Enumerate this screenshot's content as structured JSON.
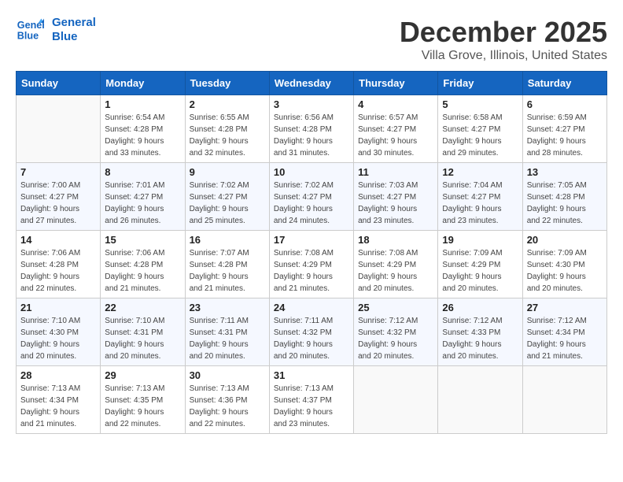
{
  "header": {
    "logo_line1": "General",
    "logo_line2": "Blue",
    "month": "December 2025",
    "location": "Villa Grove, Illinois, United States"
  },
  "weekdays": [
    "Sunday",
    "Monday",
    "Tuesday",
    "Wednesday",
    "Thursday",
    "Friday",
    "Saturday"
  ],
  "weeks": [
    [
      {
        "day": "",
        "sunrise": "",
        "sunset": "",
        "daylight": ""
      },
      {
        "day": "1",
        "sunrise": "Sunrise: 6:54 AM",
        "sunset": "Sunset: 4:28 PM",
        "daylight": "Daylight: 9 hours and 33 minutes."
      },
      {
        "day": "2",
        "sunrise": "Sunrise: 6:55 AM",
        "sunset": "Sunset: 4:28 PM",
        "daylight": "Daylight: 9 hours and 32 minutes."
      },
      {
        "day": "3",
        "sunrise": "Sunrise: 6:56 AM",
        "sunset": "Sunset: 4:28 PM",
        "daylight": "Daylight: 9 hours and 31 minutes."
      },
      {
        "day": "4",
        "sunrise": "Sunrise: 6:57 AM",
        "sunset": "Sunset: 4:27 PM",
        "daylight": "Daylight: 9 hours and 30 minutes."
      },
      {
        "day": "5",
        "sunrise": "Sunrise: 6:58 AM",
        "sunset": "Sunset: 4:27 PM",
        "daylight": "Daylight: 9 hours and 29 minutes."
      },
      {
        "day": "6",
        "sunrise": "Sunrise: 6:59 AM",
        "sunset": "Sunset: 4:27 PM",
        "daylight": "Daylight: 9 hours and 28 minutes."
      }
    ],
    [
      {
        "day": "7",
        "sunrise": "Sunrise: 7:00 AM",
        "sunset": "Sunset: 4:27 PM",
        "daylight": "Daylight: 9 hours and 27 minutes."
      },
      {
        "day": "8",
        "sunrise": "Sunrise: 7:01 AM",
        "sunset": "Sunset: 4:27 PM",
        "daylight": "Daylight: 9 hours and 26 minutes."
      },
      {
        "day": "9",
        "sunrise": "Sunrise: 7:02 AM",
        "sunset": "Sunset: 4:27 PM",
        "daylight": "Daylight: 9 hours and 25 minutes."
      },
      {
        "day": "10",
        "sunrise": "Sunrise: 7:02 AM",
        "sunset": "Sunset: 4:27 PM",
        "daylight": "Daylight: 9 hours and 24 minutes."
      },
      {
        "day": "11",
        "sunrise": "Sunrise: 7:03 AM",
        "sunset": "Sunset: 4:27 PM",
        "daylight": "Daylight: 9 hours and 23 minutes."
      },
      {
        "day": "12",
        "sunrise": "Sunrise: 7:04 AM",
        "sunset": "Sunset: 4:27 PM",
        "daylight": "Daylight: 9 hours and 23 minutes."
      },
      {
        "day": "13",
        "sunrise": "Sunrise: 7:05 AM",
        "sunset": "Sunset: 4:28 PM",
        "daylight": "Daylight: 9 hours and 22 minutes."
      }
    ],
    [
      {
        "day": "14",
        "sunrise": "Sunrise: 7:06 AM",
        "sunset": "Sunset: 4:28 PM",
        "daylight": "Daylight: 9 hours and 22 minutes."
      },
      {
        "day": "15",
        "sunrise": "Sunrise: 7:06 AM",
        "sunset": "Sunset: 4:28 PM",
        "daylight": "Daylight: 9 hours and 21 minutes."
      },
      {
        "day": "16",
        "sunrise": "Sunrise: 7:07 AM",
        "sunset": "Sunset: 4:28 PM",
        "daylight": "Daylight: 9 hours and 21 minutes."
      },
      {
        "day": "17",
        "sunrise": "Sunrise: 7:08 AM",
        "sunset": "Sunset: 4:29 PM",
        "daylight": "Daylight: 9 hours and 21 minutes."
      },
      {
        "day": "18",
        "sunrise": "Sunrise: 7:08 AM",
        "sunset": "Sunset: 4:29 PM",
        "daylight": "Daylight: 9 hours and 20 minutes."
      },
      {
        "day": "19",
        "sunrise": "Sunrise: 7:09 AM",
        "sunset": "Sunset: 4:29 PM",
        "daylight": "Daylight: 9 hours and 20 minutes."
      },
      {
        "day": "20",
        "sunrise": "Sunrise: 7:09 AM",
        "sunset": "Sunset: 4:30 PM",
        "daylight": "Daylight: 9 hours and 20 minutes."
      }
    ],
    [
      {
        "day": "21",
        "sunrise": "Sunrise: 7:10 AM",
        "sunset": "Sunset: 4:30 PM",
        "daylight": "Daylight: 9 hours and 20 minutes."
      },
      {
        "day": "22",
        "sunrise": "Sunrise: 7:10 AM",
        "sunset": "Sunset: 4:31 PM",
        "daylight": "Daylight: 9 hours and 20 minutes."
      },
      {
        "day": "23",
        "sunrise": "Sunrise: 7:11 AM",
        "sunset": "Sunset: 4:31 PM",
        "daylight": "Daylight: 9 hours and 20 minutes."
      },
      {
        "day": "24",
        "sunrise": "Sunrise: 7:11 AM",
        "sunset": "Sunset: 4:32 PM",
        "daylight": "Daylight: 9 hours and 20 minutes."
      },
      {
        "day": "25",
        "sunrise": "Sunrise: 7:12 AM",
        "sunset": "Sunset: 4:32 PM",
        "daylight": "Daylight: 9 hours and 20 minutes."
      },
      {
        "day": "26",
        "sunrise": "Sunrise: 7:12 AM",
        "sunset": "Sunset: 4:33 PM",
        "daylight": "Daylight: 9 hours and 20 minutes."
      },
      {
        "day": "27",
        "sunrise": "Sunrise: 7:12 AM",
        "sunset": "Sunset: 4:34 PM",
        "daylight": "Daylight: 9 hours and 21 minutes."
      }
    ],
    [
      {
        "day": "28",
        "sunrise": "Sunrise: 7:13 AM",
        "sunset": "Sunset: 4:34 PM",
        "daylight": "Daylight: 9 hours and 21 minutes."
      },
      {
        "day": "29",
        "sunrise": "Sunrise: 7:13 AM",
        "sunset": "Sunset: 4:35 PM",
        "daylight": "Daylight: 9 hours and 22 minutes."
      },
      {
        "day": "30",
        "sunrise": "Sunrise: 7:13 AM",
        "sunset": "Sunset: 4:36 PM",
        "daylight": "Daylight: 9 hours and 22 minutes."
      },
      {
        "day": "31",
        "sunrise": "Sunrise: 7:13 AM",
        "sunset": "Sunset: 4:37 PM",
        "daylight": "Daylight: 9 hours and 23 minutes."
      },
      {
        "day": "",
        "sunrise": "",
        "sunset": "",
        "daylight": ""
      },
      {
        "day": "",
        "sunrise": "",
        "sunset": "",
        "daylight": ""
      },
      {
        "day": "",
        "sunrise": "",
        "sunset": "",
        "daylight": ""
      }
    ]
  ]
}
